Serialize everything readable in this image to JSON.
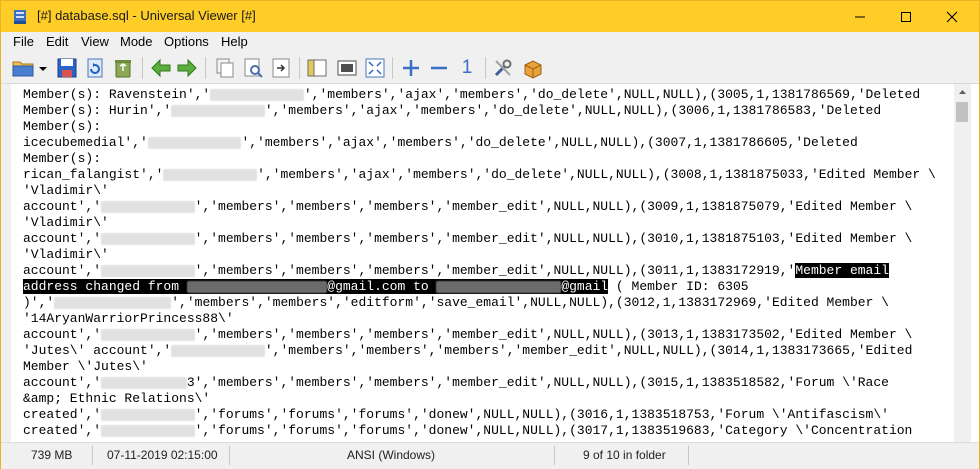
{
  "window": {
    "title": "[#] database.sql - Universal Viewer [#]",
    "accent_color": "#ffcd28",
    "controls": [
      "minimize-icon",
      "maximize-icon",
      "close-icon"
    ]
  },
  "menu": {
    "items": [
      "File",
      "Edit",
      "View",
      "Mode",
      "Options",
      "Help"
    ]
  },
  "toolbar": {
    "buttons": [
      "open-folder-icon",
      "dropdown-arrow-icon",
      "save-icon",
      "reload-icon",
      "recycle-bin-icon",
      "back-arrow-icon",
      "forward-arrow-icon",
      "copy-icon",
      "print-preview-icon",
      "export-icon",
      "panel-icon",
      "fullscreen-icon",
      "fit-window-icon",
      "zoom-in-icon",
      "zoom-out-icon",
      "original-size-icon",
      "settings-tools-icon",
      "plugin-box-icon"
    ],
    "original_size_label": "1"
  },
  "content": {
    "lines": [
      [
        {
          "t": "Member(s): Ravenstein','"
        },
        {
          "r": "            "
        },
        {
          "t": "','members','ajax','members','do_delete',NULL,NULL),(3005,1,1381786569,'Deleted"
        }
      ],
      [
        {
          "t": "Member(s): Hurin','"
        },
        {
          "r": "            "
        },
        {
          "t": "','members','ajax','members','do_delete',NULL,NULL),(3006,1,1381786583,'Deleted"
        }
      ],
      [
        {
          "t": "Member(s):"
        }
      ],
      [
        {
          "t": "icecubemedial','"
        },
        {
          "r": "            "
        },
        {
          "t": "','members','ajax','members','do_delete',NULL,NULL),(3007,1,1381786605,'Deleted"
        }
      ],
      [
        {
          "t": "Member(s):"
        }
      ],
      [
        {
          "t": "rican_falangist','"
        },
        {
          "r": "            "
        },
        {
          "t": "','members','ajax','members','do_delete',NULL,NULL),(3008,1,1381875033,'Edited Member \\"
        }
      ],
      [
        {
          "t": "'Vladimir\\'"
        }
      ],
      [
        {
          "t": "account','"
        },
        {
          "r": "            "
        },
        {
          "t": "','members','members','members','member_edit',NULL,NULL),(3009,1,1381875079,'Edited Member \\"
        }
      ],
      [
        {
          "t": "'Vladimir\\'"
        }
      ],
      [
        {
          "t": "account','"
        },
        {
          "r": "            "
        },
        {
          "t": "','members','members','members','member_edit',NULL,NULL),(3010,1,1381875103,'Edited Member \\"
        }
      ],
      [
        {
          "t": "'Vladimir\\'"
        }
      ],
      [
        {
          "t": "account','"
        },
        {
          "r": "            "
        },
        {
          "t": "','members','members','members','member_edit',NULL,NULL),(3011,1,1383172919,'"
        },
        {
          "h": "Member email"
        }
      ],
      [
        {
          "h": "address changed from "
        },
        {
          "hr": "                  "
        },
        {
          "h": "@gmail.com to "
        },
        {
          "hr": "                "
        },
        {
          "h": "@gmail"
        },
        {
          "t": " ( Member ID: 6305"
        }
      ],
      [
        {
          "t": ")','"
        },
        {
          "r": "               "
        },
        {
          "t": "','members','members','editform','save_email',NULL,NULL),(3012,1,1383172969,'Edited Member \\"
        }
      ],
      [
        {
          "t": "'14AryanWarriorPrincess88\\'"
        }
      ],
      [
        {
          "t": "account','"
        },
        {
          "r": "            "
        },
        {
          "t": "','members','members','members','member_edit',NULL,NULL),(3013,1,1383173502,'Edited Member \\"
        }
      ],
      [
        {
          "t": "'Jutes\\' account','"
        },
        {
          "r": "            "
        },
        {
          "t": "','members','members','members','member_edit',NULL,NULL),(3014,1,1383173665,'Edited"
        }
      ],
      [
        {
          "t": "Member \\'Jutes\\'"
        }
      ],
      [
        {
          "t": "account','"
        },
        {
          "r": "           "
        },
        {
          "t": "3','members','members','members','member_edit',NULL,NULL),(3015,1,1383518582,'Forum \\'Race"
        }
      ],
      [
        {
          "t": "&amp; Ethnic Relations\\'"
        }
      ],
      [
        {
          "t": "created','"
        },
        {
          "r": "            "
        },
        {
          "t": "','forums','forums','forums','donew',NULL,NULL),(3016,1,1383518753,'Forum \\'Antifascism\\'"
        }
      ],
      [
        {
          "t": "created','"
        },
        {
          "r": "            "
        },
        {
          "t": "','forums','forums','forums','donew',NULL,NULL),(3017,1,1383519683,'Category \\'Concentration"
        }
      ]
    ]
  },
  "status": {
    "size": "739 MB",
    "datetime": "07-11-2019 02:15:00",
    "encoding": "ANSI (Windows)",
    "position": "9 of 10 in folder"
  }
}
